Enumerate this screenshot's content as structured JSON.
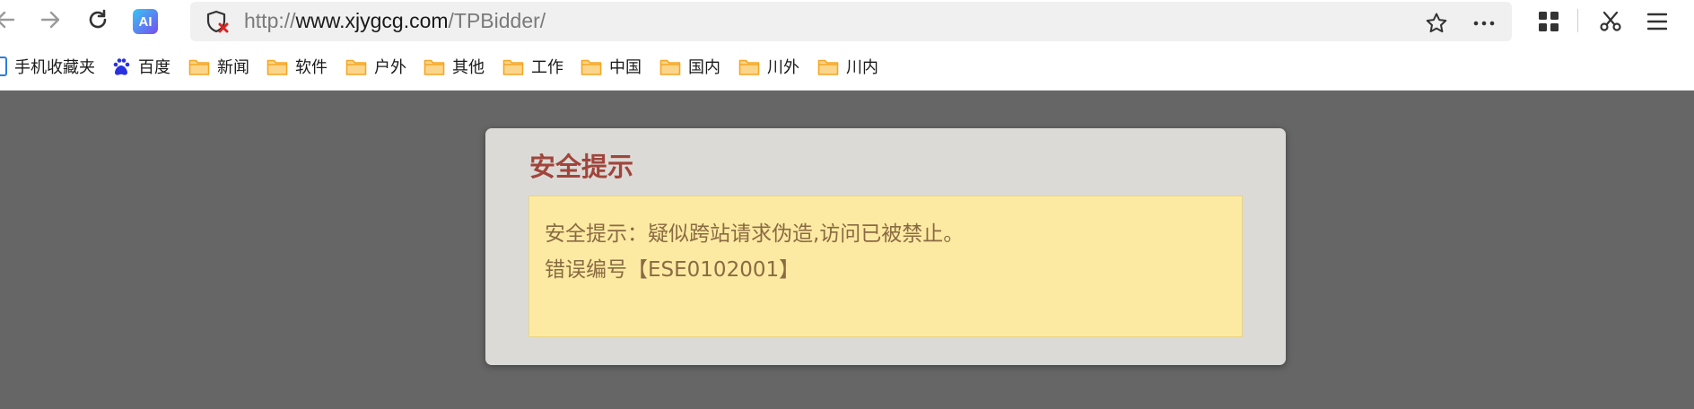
{
  "browser": {
    "url_scheme": "http://",
    "url_host": "www.xjygcg.com",
    "url_path": "/TPBidder/",
    "ai_badge": "AI",
    "icons": [
      "back-icon",
      "forward-icon",
      "reload-icon",
      "ai-icon",
      "shield-blocked-icon",
      "star-icon",
      "more-icon",
      "grid-icon",
      "scissors-icon",
      "menu-icon"
    ]
  },
  "bookmarks": [
    {
      "label": "手机收藏夹",
      "icon": "mobile-icon"
    },
    {
      "label": "百度",
      "icon": "baidu-paw-icon"
    },
    {
      "label": "新闻",
      "icon": "folder-icon"
    },
    {
      "label": "软件",
      "icon": "folder-icon"
    },
    {
      "label": "户外",
      "icon": "folder-icon"
    },
    {
      "label": "其他",
      "icon": "folder-icon"
    },
    {
      "label": "工作",
      "icon": "folder-icon"
    },
    {
      "label": "中国",
      "icon": "folder-icon"
    },
    {
      "label": "国内",
      "icon": "folder-icon"
    },
    {
      "label": "川外",
      "icon": "folder-icon"
    },
    {
      "label": "川内",
      "icon": "folder-icon"
    }
  ],
  "dialog": {
    "title": "安全提示",
    "message_line1": "安全提示：疑似跨站请求伪造,访问已被禁止。",
    "message_line2": "错误编号【ESE0102001】"
  },
  "colors": {
    "page_bg": "#666666",
    "dialog_bg": "#dcdad6",
    "title": "#a0453c",
    "message_bg": "#fdeaa2",
    "message_text": "#8a6a43",
    "folder": "#f5b335"
  }
}
